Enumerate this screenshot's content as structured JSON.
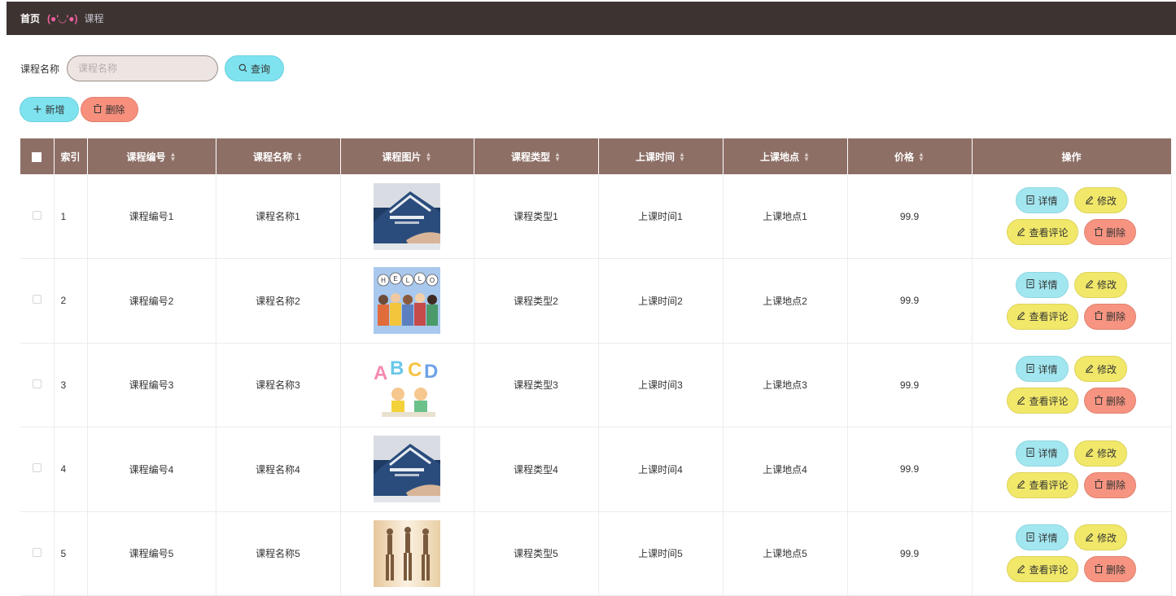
{
  "breadcrumb": {
    "home": "首页",
    "face": "(●'◡'●)",
    "current": "课程"
  },
  "search": {
    "label": "课程名称",
    "placeholder": "课程名称",
    "button": "查询"
  },
  "actions": {
    "add": "新增",
    "delete": "删除"
  },
  "table": {
    "headers": [
      "索引",
      "课程编号",
      "课程名称",
      "课程图片",
      "课程类型",
      "上课时间",
      "上课地点",
      "价格",
      "操作"
    ],
    "row_buttons": {
      "detail": "详情",
      "edit": "修改",
      "comment": "查看评论",
      "remove": "删除"
    },
    "rows": [
      {
        "index": "1",
        "code": "课程编号1",
        "name": "课程名称1",
        "image": "classroom-photo",
        "type": "课程类型1",
        "time": "上课时间1",
        "place": "上课地点1",
        "price": "99.9"
      },
      {
        "index": "2",
        "code": "课程编号2",
        "name": "课程名称2",
        "image": "hello-kids-photo",
        "type": "课程类型2",
        "time": "上课时间2",
        "place": "上课地点2",
        "price": "99.9"
      },
      {
        "index": "3",
        "code": "课程编号3",
        "name": "课程名称3",
        "image": "abcd-kids-drawing",
        "type": "课程类型3",
        "time": "上课时间3",
        "place": "上课地点3",
        "price": "99.9"
      },
      {
        "index": "4",
        "code": "课程编号4",
        "name": "课程名称4",
        "image": "classroom-photo",
        "type": "课程类型4",
        "time": "上课时间4",
        "place": "上课地点4",
        "price": "99.9"
      },
      {
        "index": "5",
        "code": "课程编号5",
        "name": "课程名称5",
        "image": "dancers-photo",
        "type": "课程类型5",
        "time": "上课时间5",
        "place": "上课地点5",
        "price": "99.9"
      }
    ]
  },
  "colors": {
    "topbar": "#3d3431",
    "header": "#8d6f66",
    "cyan": "#7ee3ef",
    "yellow": "#f1e86a",
    "salmon": "#f69481"
  }
}
